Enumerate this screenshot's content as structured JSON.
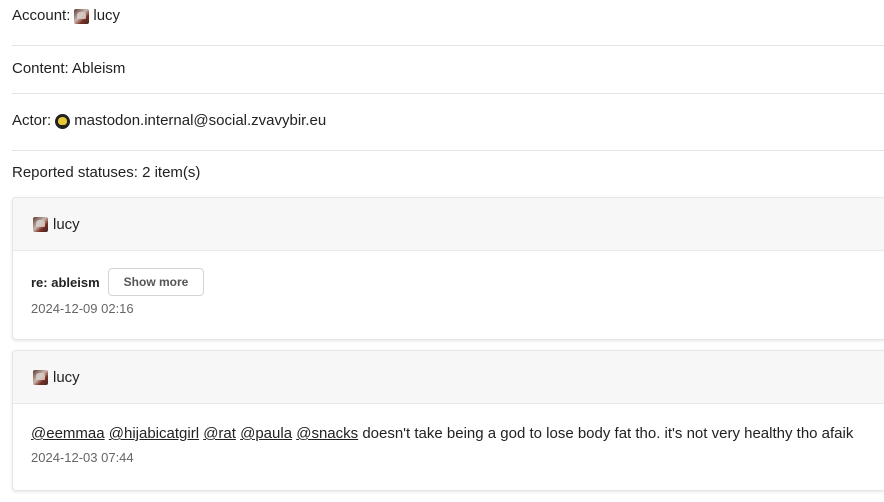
{
  "account": {
    "label": "Account:",
    "name": "lucy"
  },
  "content": {
    "label": "Content: Ableism"
  },
  "actor": {
    "label": "Actor:",
    "name": "mastodon.internal@social.zvavybir.eu"
  },
  "reported": {
    "label": "Reported statuses: 2 item(s)"
  },
  "statuses": [
    {
      "author": "lucy",
      "spoiler": "re: ableism",
      "show_more": "Show more",
      "date": "2024-12-09 02:16"
    },
    {
      "author": "lucy",
      "mentions": [
        "@eemmaa",
        "@hijabicatgirl",
        "@rat",
        "@paula",
        "@snacks"
      ],
      "text": "doesn't take being a god to lose body fat tho. it's not very healthy tho afaik",
      "date": "2024-12-03 07:44"
    }
  ]
}
